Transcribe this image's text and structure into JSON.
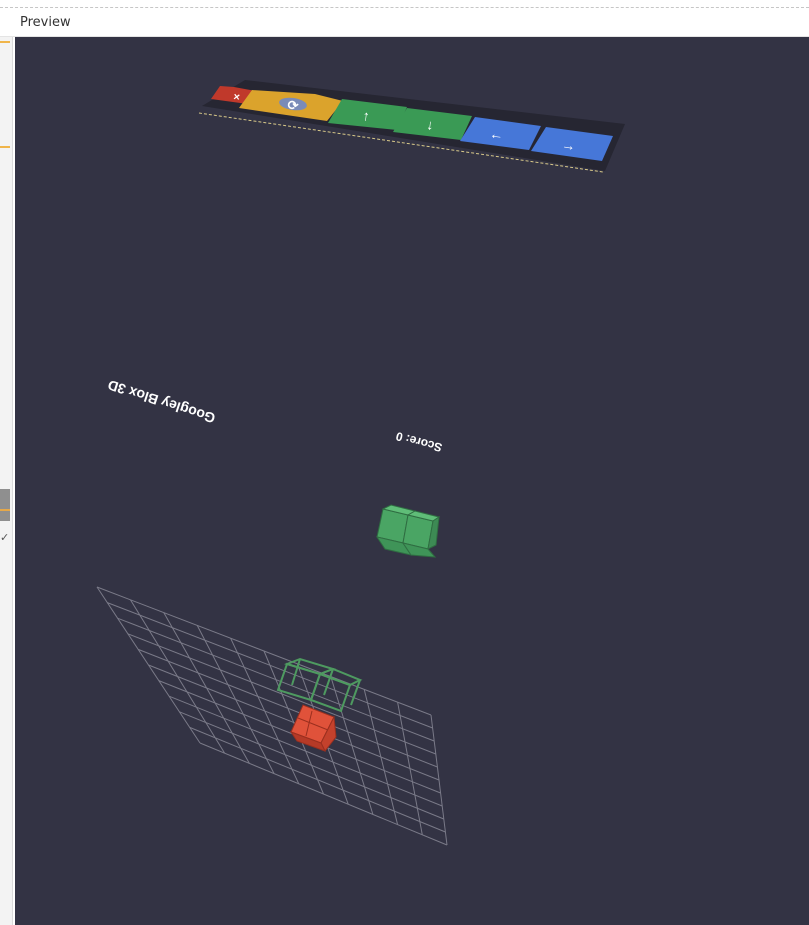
{
  "panel": {
    "title": "Preview"
  },
  "game": {
    "title": "Googley Blox 3D",
    "score_label": "Score: 0"
  },
  "controls": [
    {
      "name": "close",
      "icon": "close-icon",
      "glyph": "×",
      "color": "#c0392b"
    },
    {
      "name": "rotate",
      "icon": "rotate-icon",
      "glyph": "⟳",
      "color": "#dba32c"
    },
    {
      "name": "up",
      "icon": "arrow-up-icon",
      "glyph": "↑",
      "color": "#3a9a55"
    },
    {
      "name": "down",
      "icon": "arrow-down-icon",
      "glyph": "↓",
      "color": "#3a9a55"
    },
    {
      "name": "left",
      "icon": "arrow-left-icon",
      "glyph": "←",
      "color": "#4677d8"
    },
    {
      "name": "right",
      "icon": "arrow-right-icon",
      "glyph": "→",
      "color": "#4677d8"
    }
  ],
  "colors": {
    "background": "#333344",
    "falling_piece": "#4aa564",
    "ghost_outline": "#4e9a60",
    "landed_block": "#e0523a",
    "grid_lines": "#7a7a88"
  }
}
